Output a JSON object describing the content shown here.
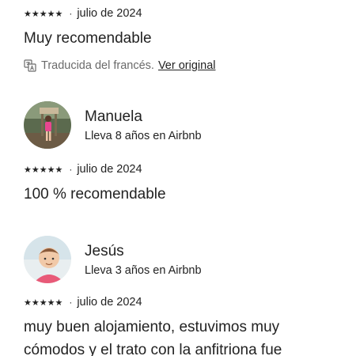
{
  "reviews": [
    {
      "stars": "★★★★★",
      "separator": "·",
      "date": "julio de 2024",
      "text": "Muy recomendable",
      "translation_note": "Traducida del francés.",
      "translation_link": "Ver original",
      "translation_icon": "translate-icon"
    },
    {
      "reviewer_name": "Manuela",
      "reviewer_tenure": "Lleva 8 años en Airbnb",
      "avatar_icon": "avatar-photo",
      "stars": "★★★★★",
      "separator": "·",
      "date": "julio de 2024",
      "text": "100 % recomendable"
    },
    {
      "reviewer_name": "Jesús",
      "reviewer_tenure": "Lleva 3 años en Airbnb",
      "avatar_icon": "avatar-photo",
      "stars": "★★★★★",
      "separator": "·",
      "date": "julio de 2024",
      "text": "muy buen alojamiento, estuvimos muy cómodos y el trato con la anfitriona fue"
    }
  ],
  "colors": {
    "text": "#222222",
    "muted": "#6a6a6a",
    "background": "#ffffff"
  }
}
